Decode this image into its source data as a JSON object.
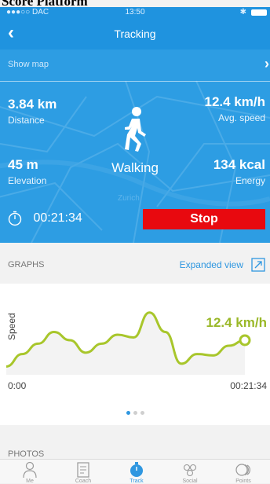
{
  "overlay_title": "Score Platform",
  "status_bar": {
    "carrier": "●●●○○ DAC",
    "time": "13:50"
  },
  "nav": {
    "title": "Tracking"
  },
  "map": {
    "show_map_label": "Show map",
    "place_name": "Zurich"
  },
  "metrics": {
    "distance": {
      "value": "3.84 km",
      "label": "Distance"
    },
    "avg_speed": {
      "value": "12.4 km/h",
      "label": "Avg. speed"
    },
    "elevation": {
      "value": "45 m",
      "label": "Elevation"
    },
    "energy": {
      "value": "134 kcal",
      "label": "Energy"
    }
  },
  "activity": "Walking",
  "timer": "00:21:34",
  "stop_label": "Stop",
  "graphs": {
    "header": "GRAPHS",
    "expanded_view": "Expanded view",
    "y_label": "Speed",
    "current_value": "12.4 km/h",
    "start_time": "0:00",
    "end_time": "00:21:34",
    "page_count": 3,
    "active_page": 0
  },
  "chart_data": {
    "type": "area",
    "series": [
      {
        "values": [
          0.12,
          0.3,
          0.45,
          0.62,
          0.5,
          0.32,
          0.45,
          0.58,
          0.54,
          0.9,
          0.62,
          0.16,
          0.3,
          0.28,
          0.42,
          0.5
        ]
      }
    ],
    "ylabel": "Speed",
    "x_start": "0:00",
    "x_end": "00:21:34",
    "color": "#a8c62b"
  },
  "photos": {
    "header": "PHOTOS"
  },
  "tabs": [
    {
      "label": "Me",
      "icon": "person-icon"
    },
    {
      "label": "Coach",
      "icon": "coach-icon"
    },
    {
      "label": "Track",
      "icon": "stopwatch-icon"
    },
    {
      "label": "Social",
      "icon": "social-icon"
    },
    {
      "label": "Points",
      "icon": "points-icon"
    }
  ],
  "colors": {
    "primary_blue": "#1f93df",
    "stop_red": "#e8090f",
    "graph_green": "#a8c62b"
  }
}
